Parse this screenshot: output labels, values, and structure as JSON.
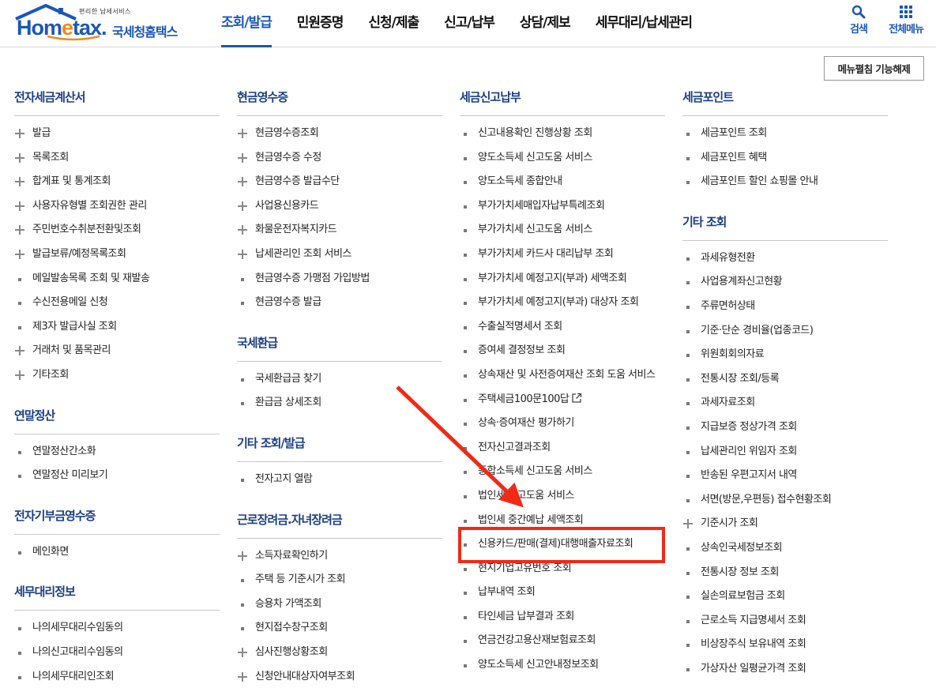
{
  "header": {
    "logo": {
      "small_text": "편리한 납세서비스",
      "home": "Hom",
      "e": "e",
      "tax": "tax.",
      "korean": "국세청홈택스"
    },
    "gnb": [
      {
        "label": "조회/발급",
        "active": true
      },
      {
        "label": "민원증명"
      },
      {
        "label": "신청/제출"
      },
      {
        "label": "신고/납부"
      },
      {
        "label": "상담/제보"
      },
      {
        "label": "세무대리/납세관리"
      }
    ],
    "search_label": "검색",
    "all_menu_label": "전체메뉴"
  },
  "fold_button_label": "메뉴펼침 기능해제",
  "columns": [
    {
      "sections": [
        {
          "title": "전자세금계산서",
          "items": [
            {
              "label": "발급",
              "icon": "plus-icon"
            },
            {
              "label": "목록조회",
              "icon": "plus-icon"
            },
            {
              "label": "합계표 및 통계조회",
              "icon": "plus-icon"
            },
            {
              "label": "사용자유형별 조회권한 관리",
              "icon": "plus-icon"
            },
            {
              "label": "주민번호수취분전환및조회",
              "icon": "plus-icon"
            },
            {
              "label": "발급보류/예정목록조회",
              "icon": "plus-icon"
            },
            {
              "label": "메일발송목록 조회 및 재발송",
              "icon": "bullet"
            },
            {
              "label": "수신전용메일 신청",
              "icon": "bullet"
            },
            {
              "label": "제3자 발급사실 조회",
              "icon": "bullet"
            },
            {
              "label": "거래처 및 품목관리",
              "icon": "plus-icon"
            },
            {
              "label": "기타조회",
              "icon": "plus-icon"
            }
          ]
        },
        {
          "title": "연말정산",
          "items": [
            {
              "label": "연말정산간소화",
              "icon": "bullet"
            },
            {
              "label": "연말정산 미리보기",
              "icon": "bullet"
            }
          ]
        },
        {
          "title": "전자기부금영수증",
          "items": [
            {
              "label": "메인화면",
              "icon": "bullet"
            }
          ]
        },
        {
          "title": "세무대리정보",
          "items": [
            {
              "label": "나의세무대리수임동의",
              "icon": "bullet"
            },
            {
              "label": "나의신고대리수임동의",
              "icon": "bullet"
            },
            {
              "label": "나의세무대리인조회",
              "icon": "bullet"
            }
          ]
        }
      ]
    },
    {
      "sections": [
        {
          "title": "현금영수증",
          "items": [
            {
              "label": "현금영수증조회",
              "icon": "plus-icon"
            },
            {
              "label": "현금영수증 수정",
              "icon": "plus-icon"
            },
            {
              "label": "현금영수증 발급수단",
              "icon": "plus-icon"
            },
            {
              "label": "사업용신용카드",
              "icon": "plus-icon"
            },
            {
              "label": "화물운전자복지카드",
              "icon": "plus-icon"
            },
            {
              "label": "납세관리인 조회 서비스",
              "icon": "plus-icon"
            },
            {
              "label": "현금영수증 가맹점 가입방법",
              "icon": "bullet"
            },
            {
              "label": "현금영수증 발급",
              "icon": "bullet"
            }
          ]
        },
        {
          "title": "국세환급",
          "items": [
            {
              "label": "국세환급금 찾기",
              "icon": "bullet"
            },
            {
              "label": "환급금 상세조회",
              "icon": "bullet"
            }
          ]
        },
        {
          "title": "기타 조회/발급",
          "items": [
            {
              "label": "전자고지 열람",
              "icon": "bullet"
            }
          ]
        },
        {
          "title": "근로장려금.자녀장려금",
          "items": [
            {
              "label": "소득자료확인하기",
              "icon": "plus-icon"
            },
            {
              "label": "주택 등 기준시가 조회",
              "icon": "bullet"
            },
            {
              "label": "승용차 가액조회",
              "icon": "bullet"
            },
            {
              "label": "현지접수창구조회",
              "icon": "bullet"
            },
            {
              "label": "심사진행상황조회",
              "icon": "plus-icon"
            },
            {
              "label": "신청안내대상자여부조회",
              "icon": "plus-icon"
            }
          ]
        }
      ]
    },
    {
      "sections": [
        {
          "title": "세금신고납부",
          "items": [
            {
              "label": "신고내용확인 진행상황 조회",
              "icon": "bullet"
            },
            {
              "label": "양도소득세 신고도움 서비스",
              "icon": "bullet"
            },
            {
              "label": "양도소득세 종합안내",
              "icon": "bullet"
            },
            {
              "label": "부가가치세매입자납부특례조회",
              "icon": "bullet"
            },
            {
              "label": "부가가치세 신고도움 서비스",
              "icon": "bullet"
            },
            {
              "label": "부가가치세 카드사 대리납부 조회",
              "icon": "bullet"
            },
            {
              "label": "부가가치세 예정고지(부과) 세액조회",
              "icon": "bullet"
            },
            {
              "label": "부가가치세 예정고지(부과) 대상자 조회",
              "icon": "bullet"
            },
            {
              "label": "수출실적명세서 조회",
              "icon": "bullet"
            },
            {
              "label": "증여세 결정정보 조회",
              "icon": "bullet"
            },
            {
              "label": "상속재산 및 사전증여재산 조회 도움 서비스",
              "icon": "bullet"
            },
            {
              "label": "주택세금100문100답",
              "icon": "bullet",
              "external": true
            },
            {
              "label": "상속·증여재산 평가하기",
              "icon": "bullet"
            },
            {
              "label": "전자신고결과조회",
              "icon": "bullet"
            },
            {
              "label": "종합소득세 신고도움 서비스",
              "icon": "bullet"
            },
            {
              "label": "법인세 신고도움 서비스",
              "icon": "bullet"
            },
            {
              "label": "법인세 중간예납 세액조회",
              "icon": "bullet"
            },
            {
              "label": "신용카드/판매(결제)대행매출자료조회",
              "icon": "bullet",
              "highlighted": true
            },
            {
              "label": "현지기업고유번호 조회",
              "icon": "bullet"
            },
            {
              "label": "납부내역 조회",
              "icon": "bullet"
            },
            {
              "label": "타인세금 납부결과 조회",
              "icon": "bullet"
            },
            {
              "label": "연금건강고용산재보험료조회",
              "icon": "bullet"
            },
            {
              "label": "양도소득세 신고안내정보조회",
              "icon": "bullet"
            }
          ]
        }
      ]
    },
    {
      "sections": [
        {
          "title": "세금포인트",
          "items": [
            {
              "label": "세금포인트 조회",
              "icon": "bullet"
            },
            {
              "label": "세금포인트 혜택",
              "icon": "bullet"
            },
            {
              "label": "세금포인트 할인 쇼핑몰 안내",
              "icon": "bullet"
            }
          ]
        },
        {
          "title": "기타 조회",
          "items": [
            {
              "label": "과세유형전환",
              "icon": "bullet"
            },
            {
              "label": "사업용계좌신고현황",
              "icon": "bullet"
            },
            {
              "label": "주류면허상태",
              "icon": "bullet"
            },
            {
              "label": "기준·단순 경비율(업종코드)",
              "icon": "bullet"
            },
            {
              "label": "위원회회의자료",
              "icon": "bullet"
            },
            {
              "label": "전통시장 조회/등록",
              "icon": "bullet"
            },
            {
              "label": "과세자료조회",
              "icon": "bullet"
            },
            {
              "label": "지급보증 정상가격 조회",
              "icon": "bullet"
            },
            {
              "label": "납세관리인 위임자 조회",
              "icon": "bullet"
            },
            {
              "label": "반송된 우편고지서 내역",
              "icon": "bullet"
            },
            {
              "label": "서면(방문,우편등) 접수현황조회",
              "icon": "bullet"
            },
            {
              "label": "기준시가 조회",
              "icon": "plus-icon"
            },
            {
              "label": "상속인국세정보조회",
              "icon": "bullet"
            },
            {
              "label": "전통시장 정보 조회",
              "icon": "bullet"
            },
            {
              "label": "실손의료보험금 조회",
              "icon": "bullet"
            },
            {
              "label": "근로소득 지급명세서 조회",
              "icon": "bullet"
            },
            {
              "label": "비상장주식 보유내역 조회",
              "icon": "bullet"
            },
            {
              "label": "가상자산 일평균가격 조회",
              "icon": "bullet"
            }
          ]
        }
      ]
    }
  ],
  "annotation": {
    "color": "#f02a17"
  },
  "colors": {
    "brand_blue": "#1b57b8",
    "section_title": "#1a3e86",
    "logo_orange": "#f08a1c"
  }
}
